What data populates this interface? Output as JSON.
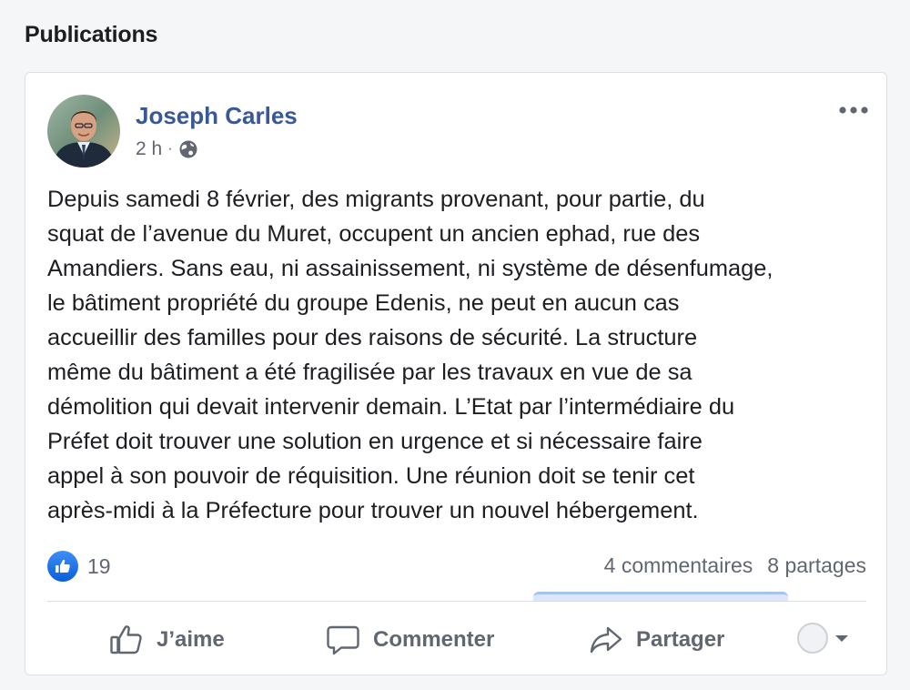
{
  "section": {
    "title": "Publications"
  },
  "post": {
    "author": "Joseph Carles",
    "time": "2 h",
    "separator": "·",
    "privacy_icon": "globe-icon",
    "more_icon": "ellipsis-icon",
    "text": "Depuis samedi 8 février, des migrants provenant, pour partie, du\nsquat de l’avenue du Muret, occupent un ancien ephad, rue des\nAmandiers. Sans eau, ni assainissement, ni système de désenfumage,\nle bâtiment propriété du groupe Edenis, ne peut en aucun cas\naccueillir des familles pour des raisons de sécurité. La structure\nmême du bâtiment a été fragilisée par les travaux en vue de sa\ndémolition qui devait intervenir demain. L’Etat par l’intermédiaire du\nPréfet doit trouver une solution en urgence et si nécessaire faire\nappel à son pouvoir de réquisition. Une réunion doit se tenir cet\naprès-midi à la Préfecture pour trouver un nouvel hébergement.",
    "reactions": {
      "icon": "like-reaction-icon",
      "count": "19"
    },
    "comments": "4 commentaires",
    "shares": "8 partages",
    "actions": {
      "like": "J’aime",
      "comment": "Commenter",
      "share": "Partager"
    }
  },
  "colors": {
    "author_link": "#385898",
    "like_blue": "#1877f2",
    "secondary_text": "#606770"
  }
}
